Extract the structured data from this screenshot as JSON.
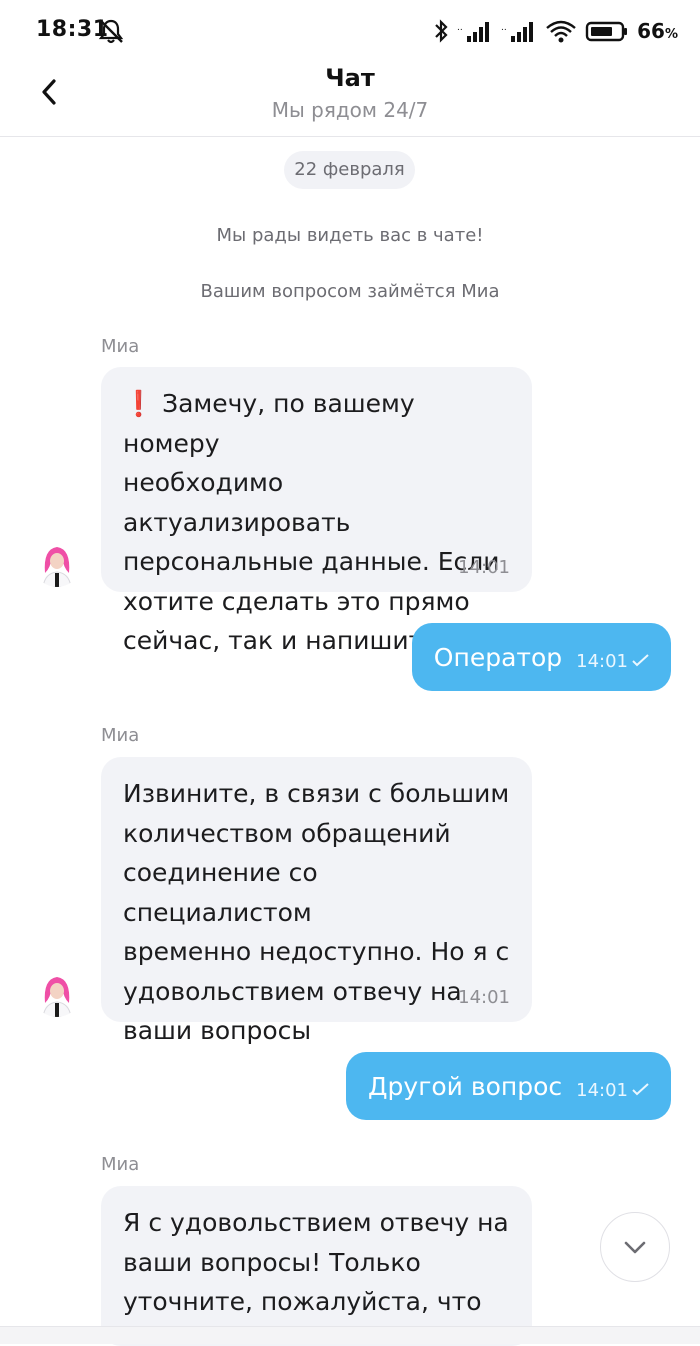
{
  "status_bar": {
    "time": "18:31",
    "battery_percent": "66",
    "battery_unit": "%",
    "icons": [
      "mute-icon",
      "bluetooth-icon",
      "signal-icon",
      "signal-icon",
      "wifi-icon",
      "battery-icon"
    ]
  },
  "header": {
    "title": "Чат",
    "subtitle": "Мы рядом 24/7"
  },
  "chat": {
    "date": "22 февраля",
    "system_messages": [
      "Мы рады видеть вас в чате!",
      "Вашим вопросом займётся Миа"
    ],
    "messages": [
      {
        "direction": "in",
        "sender": "Миа",
        "lines": [
          "❗ Замечу, по вашему номеру",
          "необходимо актуализировать",
          "персональные данные. Если",
          "хотите сделать это прямо",
          "сейчас, так и напишите"
        ],
        "time": "14:01"
      },
      {
        "direction": "out",
        "text": "Оператор",
        "time": "14:01"
      },
      {
        "direction": "in",
        "sender": "Миа",
        "lines": [
          "Извините, в связи с большим",
          "количеством обращений",
          "соединение со специалистом",
          "временно недоступно. Но я с",
          "удовольствием отвечу на",
          "ваши вопросы"
        ],
        "time": "14:01"
      },
      {
        "direction": "out",
        "text": "Другой вопрос",
        "time": "14:01"
      },
      {
        "direction": "in",
        "sender": "Миа",
        "lines": [
          "Я с удовольствием отвечу на",
          "ваши вопросы! Только",
          "уточните, пожалуйста, что"
        ]
      }
    ]
  },
  "colors": {
    "outgoing_bubble": "#4db7f0",
    "incoming_bubble": "#f2f3f7",
    "secondary_text": "#8e8e93"
  }
}
